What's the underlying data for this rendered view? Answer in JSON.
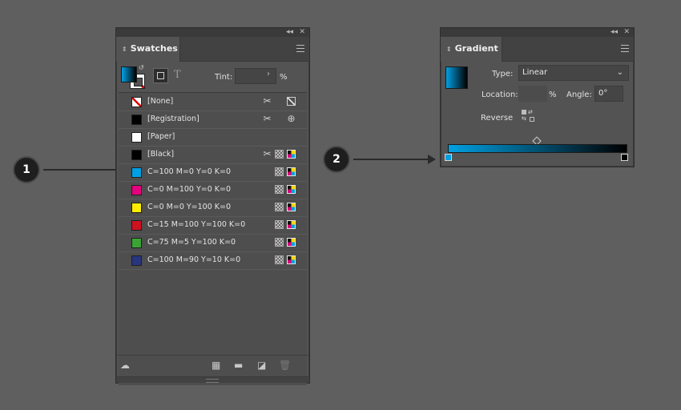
{
  "swatches_panel": {
    "title": "Swatches",
    "tint_label": "Tint:",
    "tint_value": "",
    "tint_unit": "%",
    "type_glyph": "T",
    "rows": [
      {
        "name": "[None]",
        "color": "none",
        "icons": [
          "scissors-icon",
          "none-icon"
        ]
      },
      {
        "name": "[Registration]",
        "color": "#000000",
        "icons": [
          "scissors-icon",
          "registration-icon"
        ]
      },
      {
        "name": "[Paper]",
        "color": "#ffffff",
        "icons": []
      },
      {
        "name": "[Black]",
        "color": "#000000",
        "icons": [
          "scissors-icon",
          "tint-icon",
          "cmyk-icon"
        ]
      },
      {
        "name": "C=100 M=0 Y=0 K=0",
        "color": "#00a0e3",
        "icons": [
          "tint-icon",
          "cmyk-icon"
        ]
      },
      {
        "name": "C=0 M=100 Y=0 K=0",
        "color": "#e5007e",
        "icons": [
          "tint-icon",
          "cmyk-icon"
        ]
      },
      {
        "name": "C=0 M=0 Y=100 K=0",
        "color": "#ffed00",
        "icons": [
          "tint-icon",
          "cmyk-icon"
        ]
      },
      {
        "name": "C=15 M=100 Y=100 K=0",
        "color": "#cf1120",
        "icons": [
          "tint-icon",
          "cmyk-icon"
        ]
      },
      {
        "name": "C=75 M=5 Y=100 K=0",
        "color": "#3aa535",
        "icons": [
          "tint-icon",
          "cmyk-icon"
        ]
      },
      {
        "name": "C=100 M=90 Y=10 K=0",
        "color": "#28357f",
        "icons": [
          "tint-icon",
          "cmyk-icon"
        ]
      }
    ]
  },
  "gradient_panel": {
    "title": "Gradient",
    "type_label": "Type:",
    "type_value": "Linear",
    "location_label": "Location:",
    "location_value": "",
    "location_unit": "%",
    "angle_label": "Angle:",
    "angle_value": "0°",
    "reverse_label": "Reverse",
    "gradient_start_color": "#00a0e3",
    "gradient_end_color": "#000000"
  },
  "callouts": {
    "one": "1",
    "two": "2"
  }
}
